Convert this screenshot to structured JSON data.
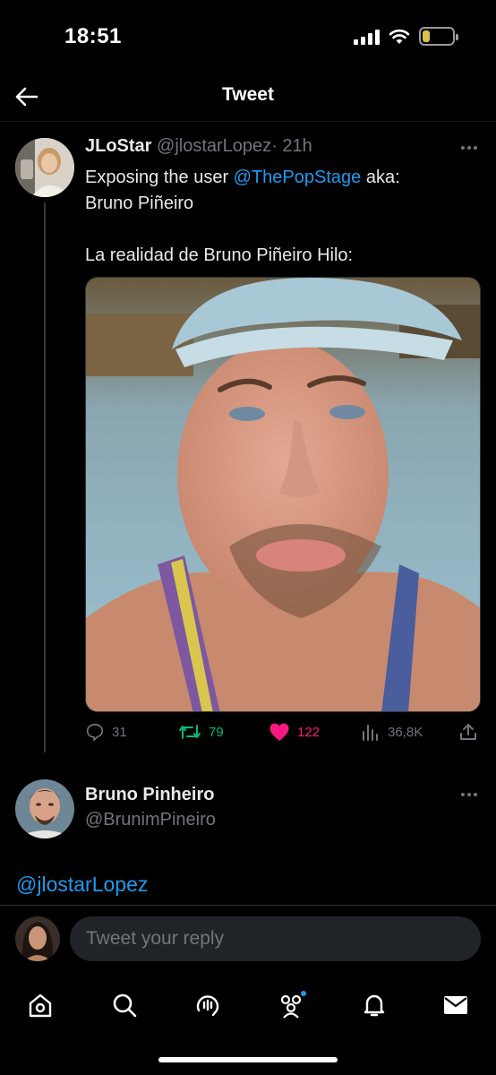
{
  "status_bar": {
    "time": "18:51",
    "battery": "13",
    "battery_level": 0.13
  },
  "header": {
    "title": "Tweet"
  },
  "tweet": {
    "author_name": "JLoStar",
    "author_handle": "@jlostarLopez",
    "separator": "·",
    "time": "21h",
    "text_prefix": "Exposing  the user ",
    "text_mention": "@ThePopStage",
    "text_suffix": " aka:",
    "text_line2": "Bruno Piñeiro",
    "text_line3": "La realidad de Bruno Piñeiro Hilo:",
    "stats": {
      "replies": "31",
      "retweets": "79",
      "likes": "122",
      "views": "36,8K"
    },
    "colors": {
      "retweet": "#00ba7c",
      "like": "#f91880",
      "mention": "#1d9bf0"
    }
  },
  "reply": {
    "author_name": "Bruno Pinheiro",
    "author_handle": "@BrunimPineiro",
    "text": "@jlostarLopez"
  },
  "compose": {
    "placeholder": "Tweet your reply"
  },
  "tab_bar": {
    "items": [
      "home-icon",
      "search-icon",
      "spaces-icon",
      "communities-icon",
      "notifications-icon",
      "messages-icon"
    ]
  }
}
